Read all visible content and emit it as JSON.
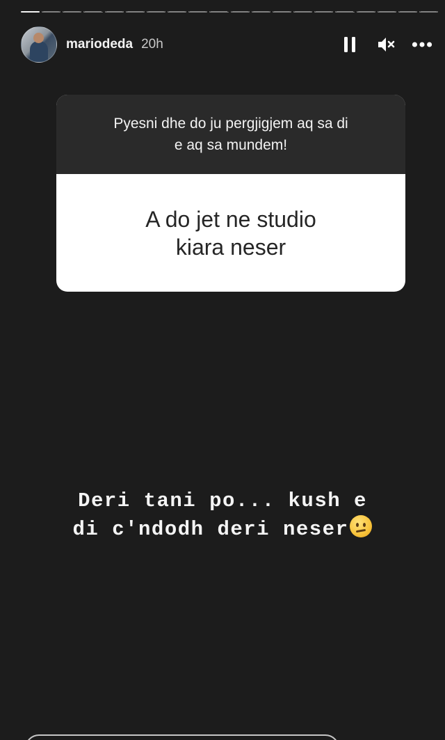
{
  "header": {
    "username": "mariodeda",
    "time": "20h",
    "avatar_icon": "profile-avatar",
    "pause_icon": "pause-icon",
    "mute_icon": "speaker-muted-icon",
    "more_icon": "more-horizontal-icon"
  },
  "progress": {
    "segments_viewed": 1,
    "segments_total": 20
  },
  "question_sticker": {
    "prompt": "Pyesni dhe do ju pergjigjem aq sa di\ne aq sa mundem!",
    "answer": "A do jet ne studio\nkiara neser"
  },
  "caption": {
    "line1": "Deri tani po... kush e",
    "line2": "di c'ndodh deri neser",
    "emoji": "confused-face-emoji"
  },
  "colors": {
    "background": "#1c1c1c",
    "prompt_bg": "#2a2a2a",
    "answer_bg": "#ffffff",
    "answer_text": "#262626"
  }
}
